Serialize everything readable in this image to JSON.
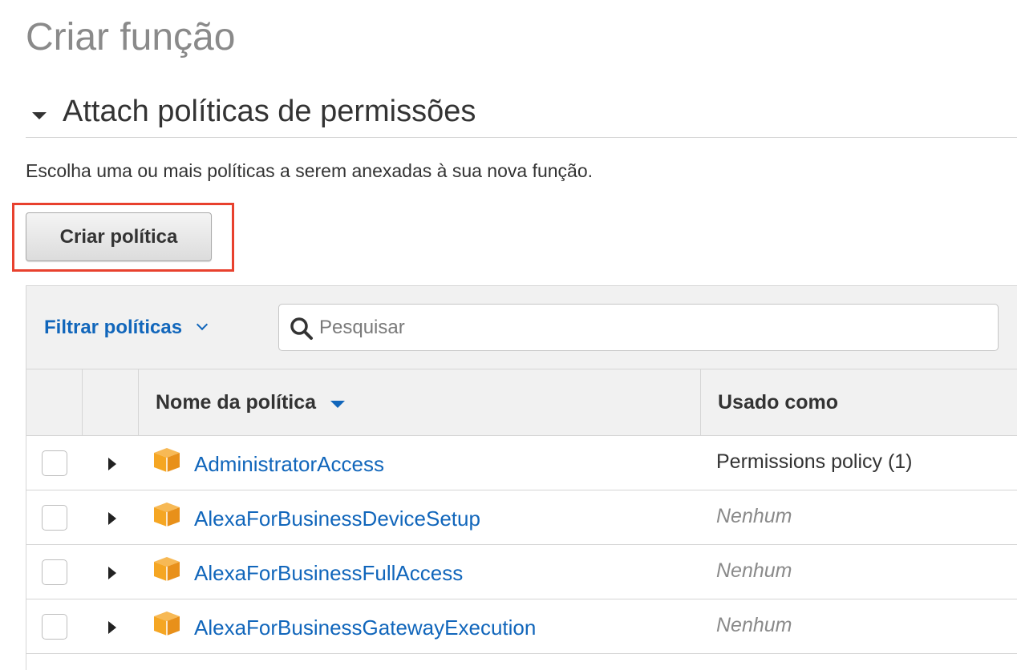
{
  "page": {
    "title": "Criar função"
  },
  "section": {
    "title": "Attach políticas de permissões",
    "description": "Escolha uma ou mais políticas a serem anexadas à sua nova função."
  },
  "toolbar": {
    "create_policy_label": "Criar política"
  },
  "filter": {
    "label": "Filtrar políticas",
    "search_placeholder": "Pesquisar",
    "search_value": ""
  },
  "table": {
    "columns": {
      "policy_name": "Nome da política",
      "used_as": "Usado como"
    },
    "rows": [
      {
        "name": "AdministratorAccess",
        "used_as": "Permissions policy (1)",
        "none": false
      },
      {
        "name": "AlexaForBusinessDeviceSetup",
        "used_as": "Nenhum",
        "none": true
      },
      {
        "name": "AlexaForBusinessFullAccess",
        "used_as": "Nenhum",
        "none": true
      },
      {
        "name": "AlexaForBusinessGatewayExecution",
        "used_as": "Nenhum",
        "none": true
      }
    ]
  },
  "colors": {
    "link": "#1166bb",
    "highlight": "#e8412e",
    "policy_icon": "#f5a623",
    "header_bg": "#f1f1f1"
  },
  "icons": {
    "section_toggle": "caret-down-icon",
    "filter_toggle": "chevron-down-icon",
    "search": "search-icon",
    "sort": "sort-down-icon",
    "row_expand": "expand-icon",
    "policy": "policy-box-icon"
  }
}
